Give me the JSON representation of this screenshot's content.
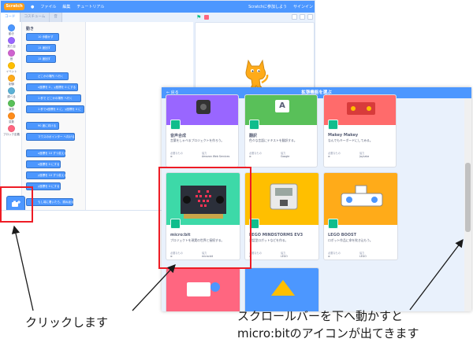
{
  "editor": {
    "menu": {
      "logo": "Scratch",
      "items": [
        "ファイル",
        "編集",
        "チュートリアル"
      ],
      "right_items": [
        "Scratchに参加しよう",
        "サインイン"
      ]
    },
    "tabs": [
      "コード",
      "コスチューム",
      "音"
    ],
    "categories": [
      {
        "label": "動き",
        "color": "#4c97ff"
      },
      {
        "label": "見た目",
        "color": "#9966ff"
      },
      {
        "label": "音",
        "color": "#cf63cf"
      },
      {
        "label": "イベント",
        "color": "#ffbf00"
      },
      {
        "label": "制御",
        "color": "#ffab19"
      },
      {
        "label": "調べる",
        "color": "#5cb1d6"
      },
      {
        "label": "演算",
        "color": "#59c059"
      },
      {
        "label": "変数",
        "color": "#ff8c1a"
      },
      {
        "label": "ブロック定義",
        "color": "#ff6680"
      }
    ],
    "palette_heading": "動き",
    "blocks": [
      "10 歩動かす",
      "15 度回す",
      "15 度回す",
      "どこかの場所 へ行く",
      "x座標を 0 、y座標を 0 にする",
      "1 秒で どこかの場所 へ行く",
      "1 秒でx座標を 0 に、y座標を 0 に",
      "90 度に向ける",
      "マウスのポインター へ向ける",
      "x座標を 10 ずつ変える",
      "x座標を 0 にする",
      "y座標を 10 ずつ変える",
      "y座標を 0 にする",
      "もし端に着いたら、跳ね返る"
    ]
  },
  "extensions": {
    "back_label": "戻る",
    "title": "拡張機能を選ぶ",
    "labels": {
      "requires": "必要なもの",
      "collab": "協力"
    },
    "cards": [
      {
        "name": "音声合成",
        "desc": "言葉をしゃべるプロジェクトを作ろう。",
        "collab": "Amazon Web Services",
        "img_color": "#9966ff",
        "badge_color": "#0fbd8c"
      },
      {
        "name": "翻訳",
        "desc": "色々な言語にテキストを翻訳する。",
        "collab": "Google",
        "img_color": "#59c059",
        "badge_color": "#0fbd8c"
      },
      {
        "name": "Makey Makey",
        "desc": "なんでもキーボードにしてみる。",
        "collab": "JoyLabz",
        "img_color": "#ff6b6b",
        "badge_color": "#0fbd8c"
      },
      {
        "name": "micro:bit",
        "desc": "プロジェクトを現実の世界と接続する。",
        "collab": "micro:bit",
        "img_color": "#3dd9a8",
        "badge_color": "#0fbd8c"
      },
      {
        "name": "LEGO MINDSTORMS EV3",
        "desc": "対話型ロボットなどを作る。",
        "collab": "LEGO",
        "img_color": "#ffbf00",
        "badge_color": "#0fbd8c"
      },
      {
        "name": "LEGO BOOST",
        "desc": "ロボット作品に命を吹き込もう。",
        "collab": "LEGO",
        "img_color": "#ffab19",
        "badge_color": "#0fbd8c"
      },
      {
        "name": "",
        "img_color": "#ff6680"
      },
      {
        "name": "",
        "img_color": "#4c97ff"
      }
    ]
  },
  "annotations": {
    "click": "クリックします",
    "scroll_line1": "スクロールバーを下へ動かすと",
    "scroll_line2": "micro:bitのアイコンが出てきます"
  },
  "highlight_color": "#ee1c25",
  "accent": "#4c97ff"
}
